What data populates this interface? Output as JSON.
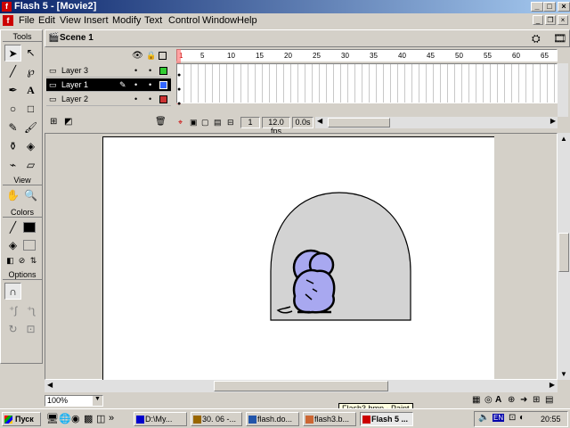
{
  "window": {
    "title": "Flash 5 - [Movie2]",
    "app_icon": "f"
  },
  "menu": [
    "File",
    "Edit",
    "View",
    "Insert",
    "Modify",
    "Text",
    "Control",
    "Window",
    "Help"
  ],
  "tools": {
    "title": "Tools",
    "view_label": "View",
    "colors_label": "Colors",
    "options_label": "Options"
  },
  "scene": {
    "label": "Scene 1"
  },
  "timeline": {
    "layers": [
      {
        "name": "Layer 3",
        "color": "#33cc33"
      },
      {
        "name": "Layer 1",
        "color": "#3366ff"
      },
      {
        "name": "Layer 2",
        "color": "#cc3333"
      }
    ],
    "ruler_ticks": [
      "1",
      "5",
      "10",
      "15",
      "20",
      "25",
      "30",
      "35",
      "40",
      "45",
      "50",
      "55",
      "60",
      "65"
    ],
    "current_frame": "1",
    "fps": "12.0 fps",
    "elapsed": "0.0s"
  },
  "zoom": {
    "value": "100%"
  },
  "tooltip": "Flash3.bmp - Paint",
  "taskbar": {
    "start": "Пуск",
    "tasks": [
      "D:\\My...",
      "30. 06 -...",
      "flash.do...",
      "flash3.b...",
      "Flash 5 ..."
    ],
    "lang": "EN",
    "clock": "20:55"
  },
  "colors": {
    "mouse_body": "#a8a8f0",
    "hole_fill": "#d3d3d3",
    "stage_bg": "#ffffff",
    "title_active": "#0a246a"
  }
}
